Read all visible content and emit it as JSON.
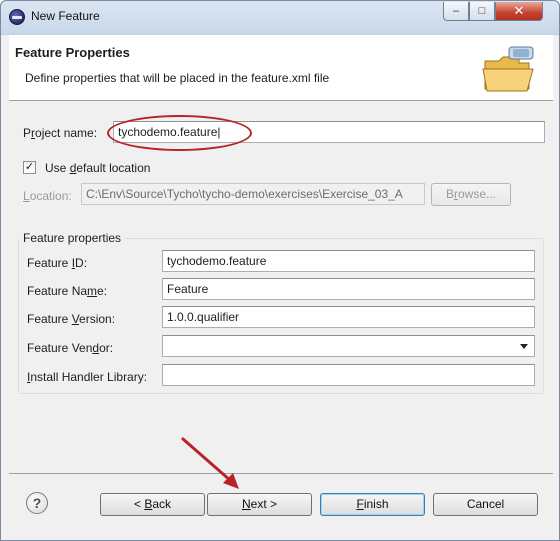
{
  "window": {
    "title": "New Feature",
    "minimize_glyph": "–",
    "maximize_glyph": "□",
    "close_glyph": "✕"
  },
  "header": {
    "title": "Feature Properties",
    "description": "Define properties that will be placed in the feature.xml file",
    "banner_icon": "folder-icon"
  },
  "project": {
    "name_label_pre": "P",
    "name_label_mn": "r",
    "name_label_post": "oject name:",
    "name_value": "tychodemo.feature",
    "use_default_prefix": "Use ",
    "use_default_mn": "d",
    "use_default_suffix": "efault location",
    "use_default_checked": true,
    "check_glyph": "✓",
    "location_label_mn": "L",
    "location_label_post": "ocation:",
    "location_value": "C:\\Env\\Source\\Tycho\\tycho-demo\\exercises\\Exercise_03_A",
    "browse_label_pre": "B",
    "browse_label_mn": "r",
    "browse_label_post": "owse..."
  },
  "feature_properties": {
    "group_title": "Feature properties",
    "id_label_pre": "Feature ",
    "id_label_mn": "I",
    "id_label_post": "D:",
    "id_value": "tychodemo.feature",
    "name_label_pre": "Feature Na",
    "name_label_mn": "m",
    "name_label_post": "e:",
    "name_value": "Feature",
    "version_label_pre": "Feature ",
    "version_label_mn": "V",
    "version_label_post": "ersion:",
    "version_value": "1.0.0.qualifier",
    "vendor_label_pre": "Feature Ven",
    "vendor_label_mn": "d",
    "vendor_label_post": "or:",
    "vendor_value": "",
    "handler_label_mn": "I",
    "handler_label_post": "nstall Handler Library:",
    "handler_value": ""
  },
  "footer": {
    "help_glyph": "?",
    "back_pre": "< ",
    "back_mn": "B",
    "back_post": "ack",
    "next_mn": "N",
    "next_post": "ext >",
    "finish_mn": "F",
    "finish_post": "inish",
    "cancel_label": "Cancel"
  },
  "colors": {
    "annotation_red": "#b72326"
  }
}
